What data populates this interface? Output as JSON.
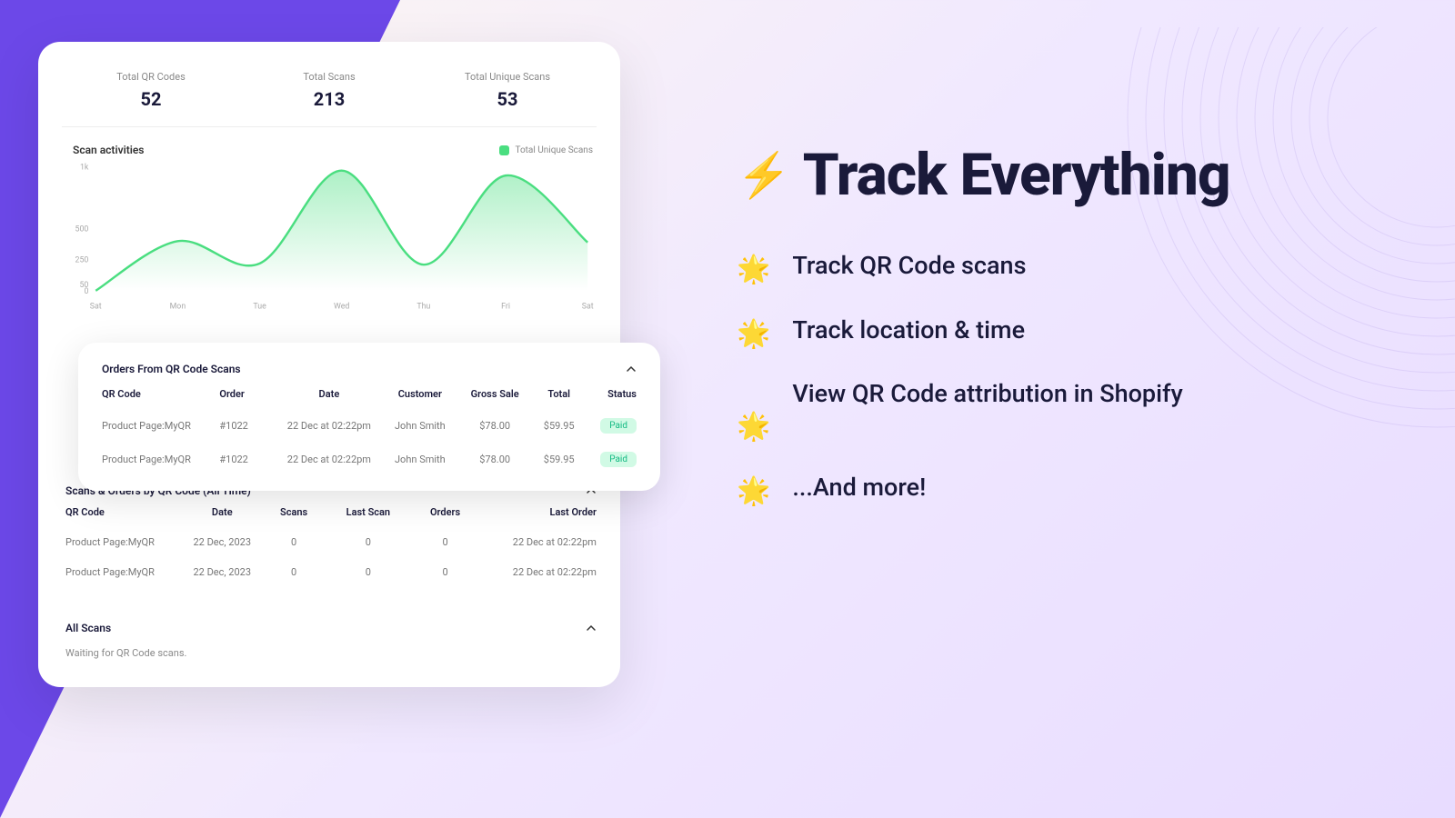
{
  "stats": {
    "qr_label": "Total QR Codes",
    "qr_value": "52",
    "scans_label": "Total Scans",
    "scans_value": "213",
    "unique_label": "Total Unique Scans",
    "unique_value": "53"
  },
  "chart": {
    "title": "Scan activities",
    "legend": "Total Unique Scans"
  },
  "chart_data": {
    "type": "area",
    "title": "Scan activities",
    "legend": "Total Unique Scans",
    "categories": [
      "Sat",
      "Mon",
      "Tue",
      "Wed",
      "Thu",
      "Fri",
      "Sat"
    ],
    "values": [
      0,
      400,
      220,
      970,
      210,
      930,
      390
    ],
    "ylim": [
      0,
      1000
    ],
    "yticks": [
      0,
      50,
      250,
      500,
      "1k"
    ],
    "color": "#4ade80"
  },
  "orders": {
    "title": "Orders From QR Code Scans",
    "headers": {
      "qr": "QR Code",
      "order": "Order",
      "date": "Date",
      "customer": "Customer",
      "gross": "Gross Sale",
      "total": "Total",
      "status": "Status"
    },
    "rows": [
      {
        "qr": "Product Page:MyQR",
        "order": "#1022",
        "date": "22 Dec at 02:22pm",
        "customer": "John Smith",
        "gross": "$78.00",
        "total": "$59.95",
        "status": "Paid"
      },
      {
        "qr": "Product Page:MyQR",
        "order": "#1022",
        "date": "22 Dec at 02:22pm",
        "customer": "John Smith",
        "gross": "$78.00",
        "total": "$59.95",
        "status": "Paid"
      }
    ]
  },
  "scansOrders": {
    "title": "Scans & Orders by QR Code (All Time)",
    "headers": {
      "qr": "QR Code",
      "date": "Date",
      "scans": "Scans",
      "last": "Last Scan",
      "orders": "Orders",
      "lastorder": "Last Order"
    },
    "rows": [
      {
        "qr": "Product Page:MyQR",
        "date": "22 Dec, 2023",
        "scans": "0",
        "last": "0",
        "orders": "0",
        "lastorder": "22 Dec at 02:22pm"
      },
      {
        "qr": "Product Page:MyQR",
        "date": "22 Dec, 2023",
        "scans": "0",
        "last": "0",
        "orders": "0",
        "lastorder": "22 Dec at 02:22pm"
      }
    ]
  },
  "allScans": {
    "title": "All Scans",
    "message": "Waiting for QR Code scans."
  },
  "feature": {
    "heading": "Track Everything",
    "items": [
      "Track QR Code scans",
      "Track location & time",
      "View QR Code attribution in Shopify",
      "...And more!"
    ]
  }
}
